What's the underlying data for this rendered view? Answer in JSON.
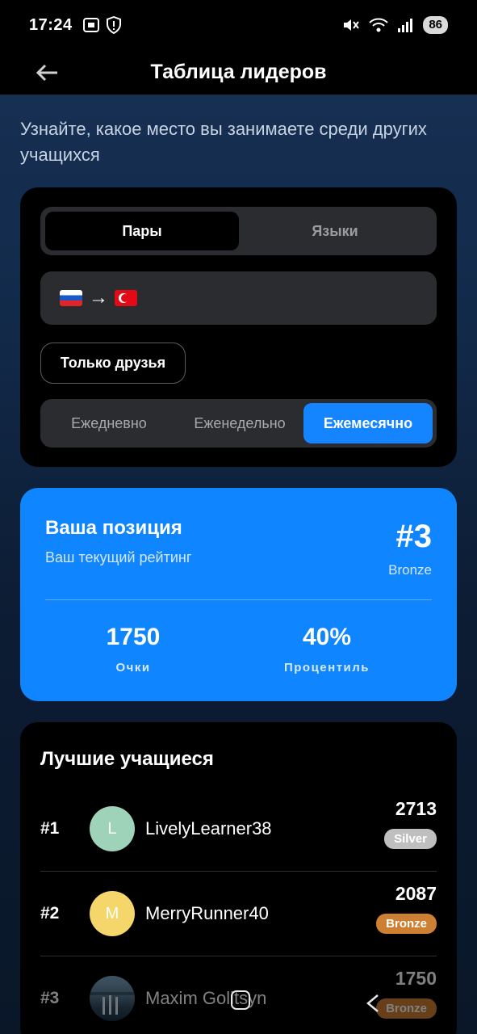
{
  "status_bar": {
    "time": "17:24",
    "battery": "86"
  },
  "app_bar": {
    "title": "Таблица лидеров",
    "back_icon": "arrow-left-icon"
  },
  "intro_text": "Узнайте, какое место вы занимаете среди других учащихся",
  "filters": {
    "mode_tabs": [
      "Пары",
      "Языки"
    ],
    "active_mode": "Пары",
    "language_pair": {
      "from_flag": "ru-flag-icon",
      "arrow": "→",
      "to_flag": "tr-flag-icon"
    },
    "friends_only_label": "Только друзья",
    "periods": [
      "Ежедневно",
      "Еженедельно",
      "Ежемесячно"
    ],
    "active_period": "Ежемесячно"
  },
  "your_position": {
    "title": "Ваша позиция",
    "subtitle": "Ваш текущий рейтинг",
    "rank": "#3",
    "league": "Bronze",
    "points_value": "1750",
    "points_label": "Очки",
    "percentile_value": "40%",
    "percentile_label": "Процентиль"
  },
  "top_learners": {
    "title": "Лучшие учащиеся",
    "rows": [
      {
        "rank": "#1",
        "initial": "L",
        "avatar_color": "#9fd3b9",
        "name": "LivelyLearner38",
        "points": "2713",
        "league": "Silver"
      },
      {
        "rank": "#2",
        "initial": "M",
        "avatar_color": "#f5d66b",
        "name": "MerryRunner40",
        "points": "2087",
        "league": "Bronze"
      },
      {
        "rank": "#3",
        "initial": "",
        "avatar_color": "",
        "name": "Maxim Golitsyn",
        "points": "1750",
        "league": "Bronze"
      }
    ]
  },
  "colors": {
    "accent": "#1584ff",
    "position_card": "#0f86ff",
    "silver": "#bfbfbf",
    "bronze": "#cd7f32"
  }
}
